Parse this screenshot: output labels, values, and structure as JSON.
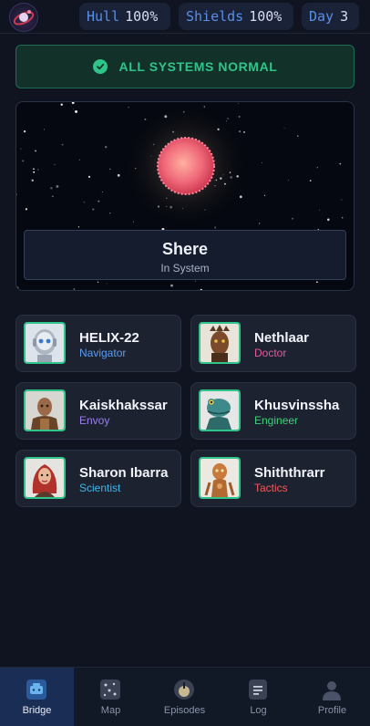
{
  "header": {
    "logo_icon": "ship-emblem-icon",
    "stats": [
      {
        "label": "Hull",
        "value": "100%"
      },
      {
        "label": "Shields",
        "value": "100%"
      },
      {
        "label": "Day",
        "value": "3"
      }
    ]
  },
  "status": {
    "text": "ALL SYSTEMS NORMAL",
    "icon": "check-circle-icon",
    "color": "#2fc48a"
  },
  "location": {
    "name": "Shere",
    "state": "In System",
    "planet_color": "#f06a7a"
  },
  "crew": [
    {
      "name": "HELIX-22",
      "role": "Navigator",
      "role_color": "#5a9bf0",
      "portrait": "robot-portrait"
    },
    {
      "name": "Nethlaar",
      "role": "Doctor",
      "role_color": "#e45a9e",
      "portrait": "bark-alien-portrait"
    },
    {
      "name": "Kaiskhakssar",
      "role": "Envoy",
      "role_color": "#9b7ff0",
      "portrait": "armored-alien-portrait"
    },
    {
      "name": "Khusvinssha",
      "role": "Engineer",
      "role_color": "#3fd07a",
      "portrait": "reptile-alien-portrait"
    },
    {
      "name": "Sharon Ibarra",
      "role": "Scientist",
      "role_color": "#3fb6e8",
      "portrait": "human-woman-portrait"
    },
    {
      "name": "Shiththrarr",
      "role": "Tactics",
      "role_color": "#f05a5a",
      "portrait": "copper-alien-portrait"
    }
  ],
  "nav": [
    {
      "label": "Bridge",
      "icon": "console-icon",
      "active": true
    },
    {
      "label": "Map",
      "icon": "star-map-icon",
      "active": false
    },
    {
      "label": "Episodes",
      "icon": "episodes-icon",
      "active": false
    },
    {
      "label": "Log",
      "icon": "log-icon",
      "active": false
    },
    {
      "label": "Profile",
      "icon": "profile-icon",
      "active": false
    }
  ]
}
